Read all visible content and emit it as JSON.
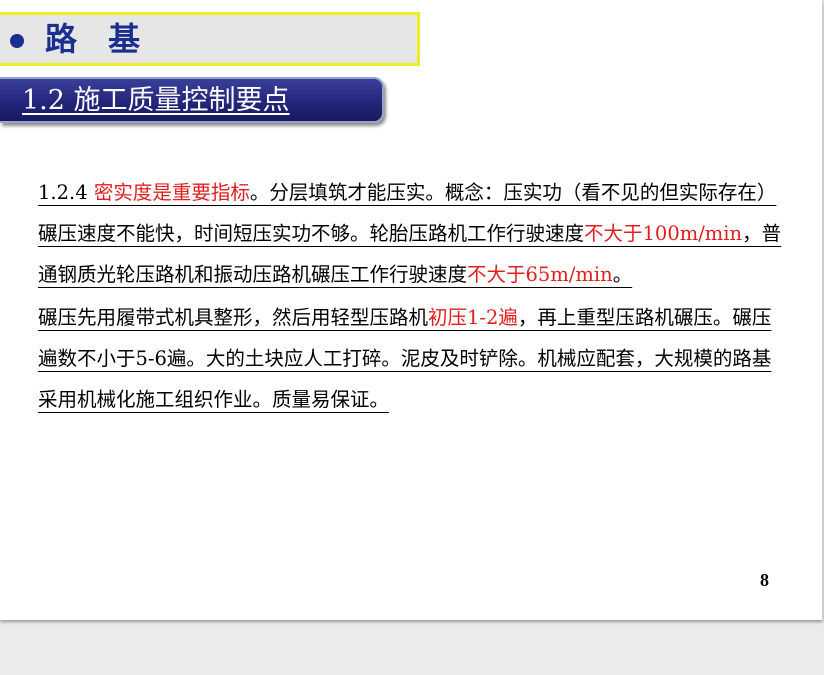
{
  "header": {
    "title": "路 基",
    "section": "1.2 施工质量控制要点"
  },
  "content": {
    "paragraph1": {
      "number": "1.2.4 ",
      "highlight1": "密实度是重要指标",
      "text1": "。分层填筑才能压实。概念：压实功（看不见的但实际存在）碾压速度不能快，时间短压实功不够。轮胎压路机工作行驶速度",
      "highlight2": "不大于100m/min",
      "text2": "，普通钢质光轮压路机和振动压路机碾压工作行驶速度",
      "highlight3": "不大于65m/min",
      "text3": "。"
    },
    "paragraph2": {
      "text1": "碾压先用履带式机具整形，然后用轻型压路机",
      "highlight1": "初压1-2遍",
      "text2": "，再上重型压路机碾压。碾压遍数不小于5-6遍。大的土块应人工打碎。泥皮及时铲除。机械应配套，大规模的路基采用机械化施工组织作业。质量易保证。"
    }
  },
  "footer": {
    "page_number": "8"
  },
  "colors": {
    "title": "#1b2f8f",
    "title_border": "#ecec2a",
    "banner": "#23267a",
    "highlight": "#e02020"
  }
}
